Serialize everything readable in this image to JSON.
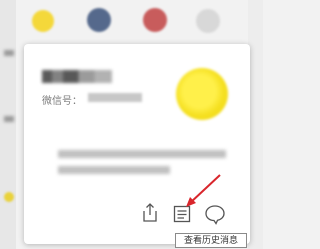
{
  "contact_card": {
    "nickname": "",
    "wechat_id_label": "微信号：",
    "wechat_id_value": "",
    "signature": ""
  },
  "actions": [
    {
      "name": "share-icon",
      "label": ""
    },
    {
      "name": "chat-history-icon",
      "label": ""
    },
    {
      "name": "message-icon",
      "label": ""
    }
  ],
  "tooltip": {
    "text": "查看历史消息"
  },
  "colors": {
    "annotation_arrow": "#d9262c",
    "icon_stroke": "#555555",
    "card_background": "#ffffff",
    "page_background": "#f2f2f2"
  }
}
